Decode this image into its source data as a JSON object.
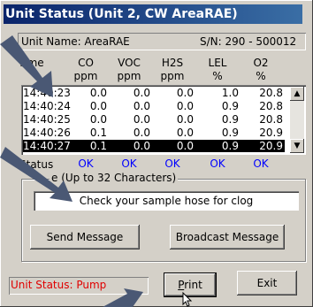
{
  "window": {
    "title": "Unit Status (Unit 2, CW AreaRAE)"
  },
  "unit": {
    "name_label": "Unit Name: AreaRAE",
    "serial_label": "S/N: 290 - 500012"
  },
  "columns": [
    {
      "name": "Time",
      "unit": ""
    },
    {
      "name": "CO",
      "unit": "ppm"
    },
    {
      "name": "VOC",
      "unit": "ppm"
    },
    {
      "name": "H2S",
      "unit": "ppm"
    },
    {
      "name": "LEL",
      "unit": "%"
    },
    {
      "name": "O2",
      "unit": "%"
    }
  ],
  "rows": [
    {
      "time": "14:40:23",
      "co": "0.0",
      "voc": "0.0",
      "h2s": "0.0",
      "lel": "1.0",
      "o2": "20.8"
    },
    {
      "time": "14:40:24",
      "co": "0.0",
      "voc": "0.0",
      "h2s": "0.0",
      "lel": "0.9",
      "o2": "20.8"
    },
    {
      "time": "14:40:25",
      "co": "0.0",
      "voc": "0.0",
      "h2s": "0.0",
      "lel": "0.9",
      "o2": "20.8"
    },
    {
      "time": "14:40:26",
      "co": "0.1",
      "voc": "0.0",
      "h2s": "0.0",
      "lel": "0.9",
      "o2": "20.9"
    },
    {
      "time": "14:40:27",
      "co": "0.1",
      "voc": "0.0",
      "h2s": "0.0",
      "lel": "0.9",
      "o2": "20.9"
    }
  ],
  "selected_row": 4,
  "status": {
    "label": "Status",
    "values": [
      "OK",
      "OK",
      "OK",
      "OK",
      "OK"
    ]
  },
  "message": {
    "group_label": "e (Up to 32 Characters)",
    "text": "Check your sample hose for clog",
    "send_label": "Send Message",
    "broadcast_label": "Broadcast Message"
  },
  "footer": {
    "unit_status": "Unit Status: Pump",
    "print_label": "Print",
    "print_mnemonic": "P",
    "exit_label": "Exit"
  },
  "colors": {
    "title_bar": "#0a246a",
    "ok": "#0000ff",
    "status_text": "#e00000",
    "arrow": "#4a5874"
  },
  "icons": {
    "scroll_up": "▲",
    "scroll_down": "▼"
  }
}
